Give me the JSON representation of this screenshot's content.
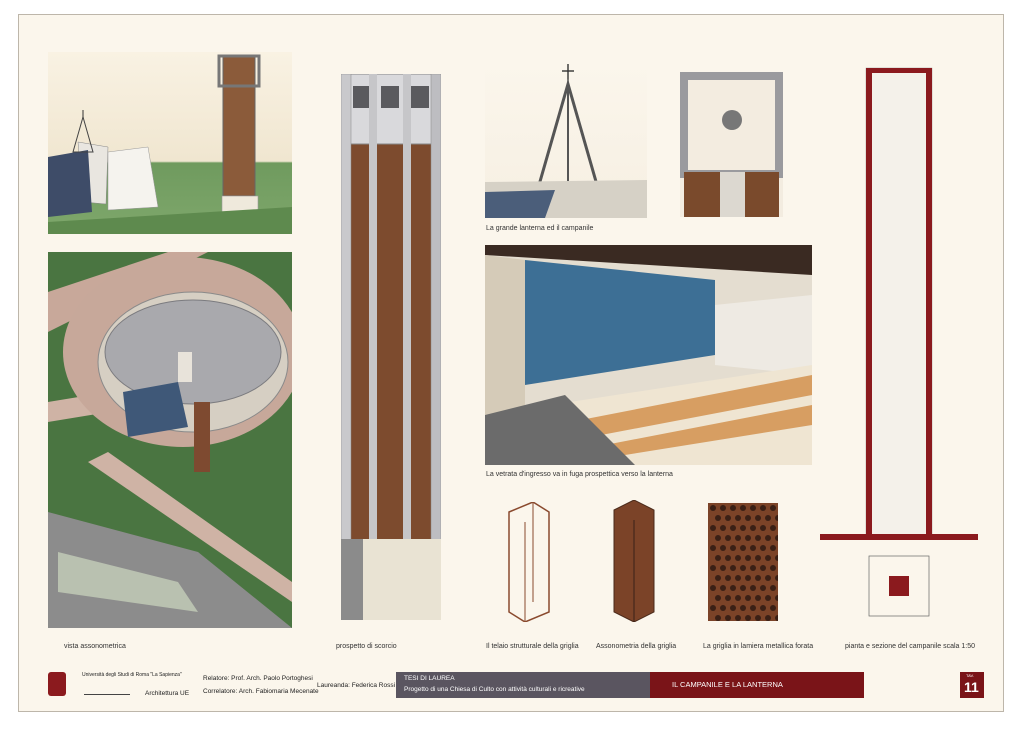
{
  "captions": {
    "axonometric": "vista assonometrica",
    "perspective": "prospetto di scorcio",
    "lantern": "La grande lanterna ed il campanile",
    "window": "La vetrata d'ingresso va in fuga prospettica verso la lanterna",
    "frame": "Il telaio strutturale della griglia",
    "axo_grid": "Assonometria della griglia",
    "sheet_metal": "La griglia in lamiera metallica forata",
    "plan": "pianta e sezione del campanile scala 1:50"
  },
  "footer": {
    "university": "Università degli Studi di Roma \"La Sapienza\"",
    "faculty": "Architettura UE",
    "relatore": "Relatore: Prof. Arch. Paolo Portoghesi",
    "correlatore": "Correlatore: Arch. Fabiomaria Mecenate",
    "laureanda": "Laureanda: Federica Rossi",
    "thesis_label": "TESI DI LAUREA",
    "thesis_title": "Progetto di una Chiesa di Culto con attività culturali e ricreative",
    "sheet_title": "IL CAMPANILE E LA LANTERNA",
    "tav_label": "TAV.",
    "tav_number": "11"
  },
  "colors": {
    "accent": "#7a1418",
    "dark_bar": "#5a5560",
    "grass": "#3f6e3a"
  }
}
